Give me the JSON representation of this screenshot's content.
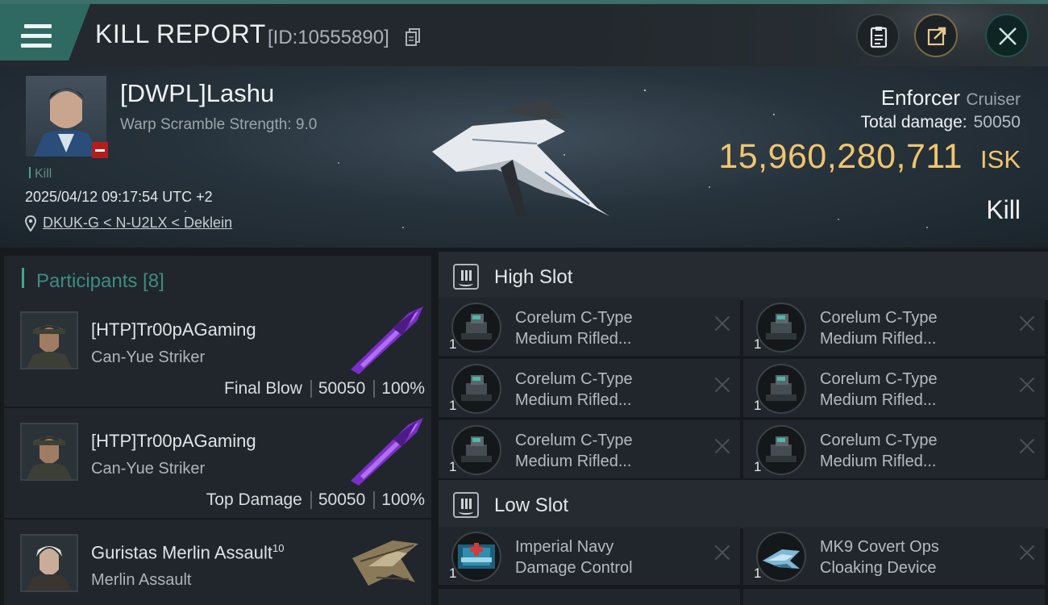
{
  "header": {
    "title": "KILL REPORT",
    "report_id": "[ID:10555890]",
    "icons": {
      "menu": "hamburger-menu-icon",
      "copy": "copy-icon",
      "clipboard": "clipboard-icon",
      "share": "share-icon",
      "close": "close-icon"
    },
    "colors": {
      "accent": "#2f6a62",
      "share_ring": "#7a6a45"
    }
  },
  "victim": {
    "name": "[DWPL]Lashu",
    "warp_scramble": "Warp Scramble Strength: 9.0",
    "tag": "Kill",
    "timestamp": "2025/04/12 09:17:54 UTC +2",
    "location": "DKUK-G < N-U2LX < Deklein",
    "ship_name": "Enforcer",
    "ship_class": "Cruiser",
    "total_damage_label": "Total damage:",
    "total_damage": "50050",
    "isk_value": "15,960,280,711",
    "isk_unit": "ISK",
    "result": "Kill",
    "colors": {
      "isk": "#f1c56e",
      "badge": "#b51c1c"
    }
  },
  "participants": {
    "title": "Participants [8]",
    "items": [
      {
        "name": "[HTP]Tr00pAGaming",
        "ship": "Can-Yue Striker",
        "role": "Final Blow",
        "damage": "50050",
        "percent": "100%",
        "weapon_icon": "purple-blade-icon"
      },
      {
        "name": "[HTP]Tr00pAGaming",
        "ship": "Can-Yue Striker",
        "role": "Top Damage",
        "damage": "50050",
        "percent": "100%",
        "weapon_icon": "purple-blade-icon"
      },
      {
        "name": "Guristas Merlin Assault",
        "name_sup": "10",
        "ship": "Merlin Assault",
        "weapon_icon": "merlin-ship-icon"
      }
    ]
  },
  "slots": {
    "high": {
      "title": "High Slot",
      "modules": [
        {
          "line1": "Corelum C-Type",
          "line2": "Medium Rifled...",
          "qty": "1"
        },
        {
          "line1": "Corelum C-Type",
          "line2": "Medium Rifled...",
          "qty": "1"
        },
        {
          "line1": "Corelum C-Type",
          "line2": "Medium Rifled...",
          "qty": "1"
        },
        {
          "line1": "Corelum C-Type",
          "line2": "Medium Rifled...",
          "qty": "1"
        },
        {
          "line1": "Corelum C-Type",
          "line2": "Medium Rifled...",
          "qty": "1"
        },
        {
          "line1": "Corelum C-Type",
          "line2": "Medium Rifled...",
          "qty": "1"
        }
      ]
    },
    "low": {
      "title": "Low Slot",
      "modules": [
        {
          "line1": "Imperial Navy",
          "line2": "Damage Control",
          "qty": "1"
        },
        {
          "line1": "MK9 Covert Ops",
          "line2": "Cloaking Device",
          "qty": "1"
        }
      ]
    }
  }
}
